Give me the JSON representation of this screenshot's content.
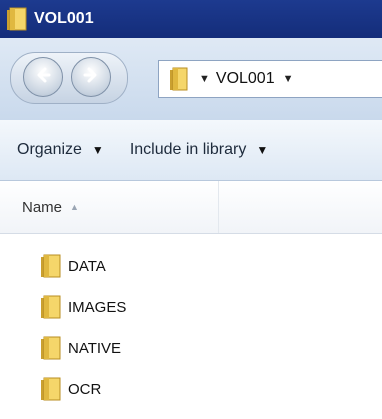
{
  "window": {
    "title": "VOL001"
  },
  "address": {
    "crumb": "VOL001"
  },
  "toolbar": {
    "organize_label": "Organize",
    "include_label": "Include in library"
  },
  "columns": {
    "name_label": "Name"
  },
  "files": [
    {
      "name": "DATA"
    },
    {
      "name": "IMAGES"
    },
    {
      "name": "NATIVE"
    },
    {
      "name": "OCR"
    }
  ],
  "colors": {
    "titlebar": "#1d3a8f",
    "folder": "#e8b93a"
  }
}
